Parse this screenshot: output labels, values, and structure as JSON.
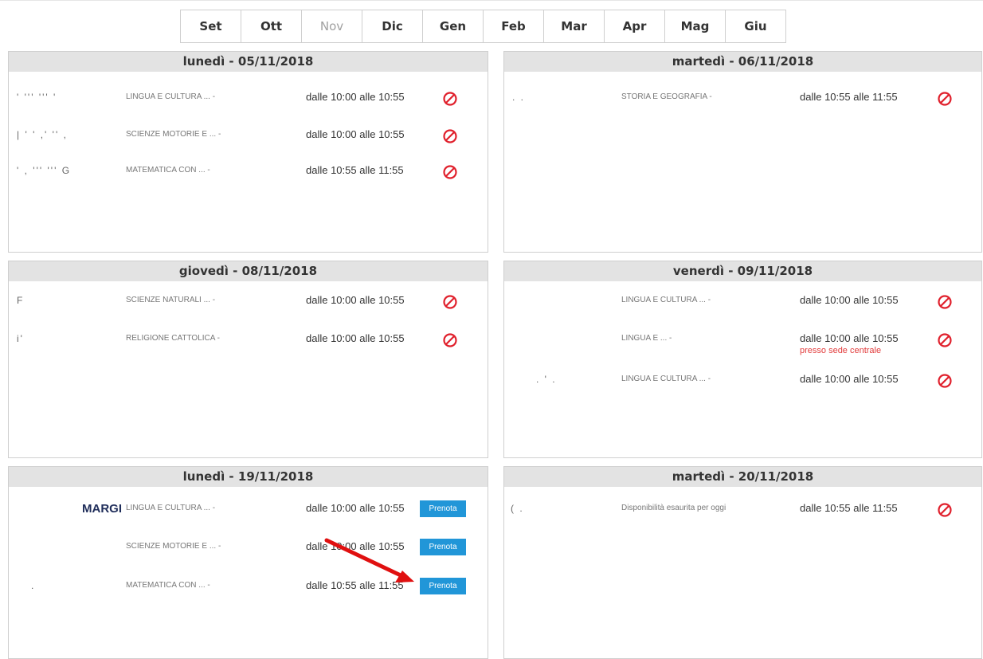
{
  "months": [
    {
      "label": "Set",
      "disabled": false
    },
    {
      "label": "Ott",
      "disabled": false
    },
    {
      "label": "Nov",
      "disabled": true
    },
    {
      "label": "Dic",
      "disabled": false
    },
    {
      "label": "Gen",
      "disabled": false
    },
    {
      "label": "Feb",
      "disabled": false
    },
    {
      "label": "Mar",
      "disabled": false
    },
    {
      "label": "Apr",
      "disabled": false
    },
    {
      "label": "Mag",
      "disabled": false
    },
    {
      "label": "Giu",
      "disabled": false
    }
  ],
  "days": [
    {
      "header": "lunedì - 05/11/2018",
      "slots": [
        {
          "teacher": "' ''' '''  '",
          "subject": "LINGUA E CULTURA ... -",
          "time": "dalle 10:00 alle 10:55",
          "action": "blocked"
        },
        {
          "teacher": "| '  ' ,' ''  ,",
          "subject": "SCIENZE MOTORIE E ... -",
          "time": "dalle 10:00 alle 10:55",
          "action": "blocked"
        },
        {
          "teacher": "'  ,  ''' ''' G",
          "subject": "MATEMATICA CON ... -",
          "time": "dalle 10:55 alle 11:55",
          "action": "blocked"
        }
      ]
    },
    {
      "header": "martedì - 06/11/2018",
      "slots": [
        {
          "teacher": ".        .",
          "subject": "STORIA E GEOGRAFIA -",
          "time": "dalle 10:55 alle 11:55",
          "action": "blocked"
        }
      ]
    },
    {
      "header": "giovedì - 08/11/2018",
      "slots": [
        {
          "teacher": "F",
          "subject": "SCIENZE NATURALI ... -",
          "time": "dalle 10:00 alle 10:55",
          "action": "blocked"
        },
        {
          "teacher": "i'",
          "subject": "RELIGIONE CATTOLICA -",
          "time": "dalle 10:00 alle 10:55",
          "action": "blocked"
        }
      ]
    },
    {
      "header": "venerdì - 09/11/2018",
      "slots": [
        {
          "teacher": "",
          "subject": "LINGUA E CULTURA ... -",
          "time": "dalle 10:00 alle 10:55",
          "action": "blocked"
        },
        {
          "teacher": "",
          "subject": "LINGUA E ... -",
          "time": "dalle 10:00 alle 10:55",
          "note": "presso sede centrale",
          "action": "blocked"
        },
        {
          "teacher": ".   '  .",
          "subject": "LINGUA E CULTURA ... -",
          "time": "dalle 10:00 alle 10:55",
          "action": "blocked"
        }
      ]
    },
    {
      "header": "lunedì - 19/11/2018",
      "slots": [
        {
          "teacher": "MARGI",
          "subject": "LINGUA E CULTURA ... -",
          "time": "dalle 10:00 alle 10:55",
          "action": "book",
          "button": "Prenota"
        },
        {
          "teacher": "",
          "subject": "SCIENZE MOTORIE E ... -",
          "time": "dalle 10:00 alle 10:55",
          "action": "book",
          "button": "Prenota"
        },
        {
          "teacher": ".",
          "subject": "MATEMATICA CON ... -",
          "time": "dalle 10:55 alle 11:55",
          "action": "book",
          "button": "Prenota"
        }
      ]
    },
    {
      "header": "martedì - 20/11/2018",
      "slots": [
        {
          "teacher": "(  .",
          "subject": "Disponibilità esaurita per oggi",
          "time": "dalle 10:55 alle 11:55",
          "action": "blocked"
        }
      ]
    }
  ],
  "colors": {
    "accent": "#2196d8",
    "blocked": "#e0202c",
    "arrow": "#e01010"
  }
}
